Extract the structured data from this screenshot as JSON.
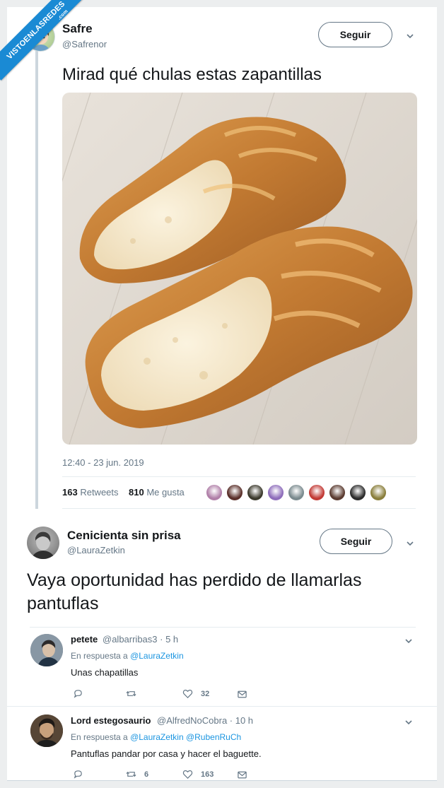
{
  "watermark": {
    "text": "VISTOENLASREDES",
    "sub": ".com"
  },
  "main_tweet": {
    "name": "Safre",
    "handle": "@Safrenor",
    "follow_label": "Seguir",
    "text": "Mirad qué chulas estas zapantillas",
    "timestamp": "12:40 - 23 jun. 2019",
    "retweets_count": "163",
    "retweets_label": "Retweets",
    "likes_count": "810",
    "likes_label": "Me gusta",
    "liker_colors": [
      "#b07fa8",
      "#5a2f2a",
      "#3c3a2d",
      "#8e6dbb",
      "#7a8a8e",
      "#c23a35",
      "#5b3b30",
      "#2c2c2c",
      "#8a7f3c"
    ]
  },
  "quoted_tweet": {
    "name": "Cenicienta sin prisa",
    "handle": "@LauraZetkin",
    "follow_label": "Seguir",
    "text_line1": "Vaya oportunidad has perdido de llamarlas",
    "text_line2": "pantuflas"
  },
  "replies": [
    {
      "name": "petete",
      "handle": "@albarribas3 · 5 h",
      "reply_prefix": "En respuesta a",
      "reply_to": "@LauraZetkin",
      "text": "Unas chapatillas",
      "reply_count": "",
      "retweet_count": "",
      "like_count": "32"
    },
    {
      "name": "Lord estegosaurio",
      "handle": "@AlfredNoCobra · 10 h",
      "reply_prefix": "En respuesta a",
      "reply_to": "@LauraZetkin @RubenRuCh",
      "text": "Pantuflas pandar por casa y hacer el baguette.",
      "reply_count": "",
      "retweet_count": "6",
      "like_count": "163"
    }
  ],
  "colors": {
    "accent": "#1b95e0",
    "secondary_text": "#657786",
    "ribbon": "#1a8ad4"
  }
}
